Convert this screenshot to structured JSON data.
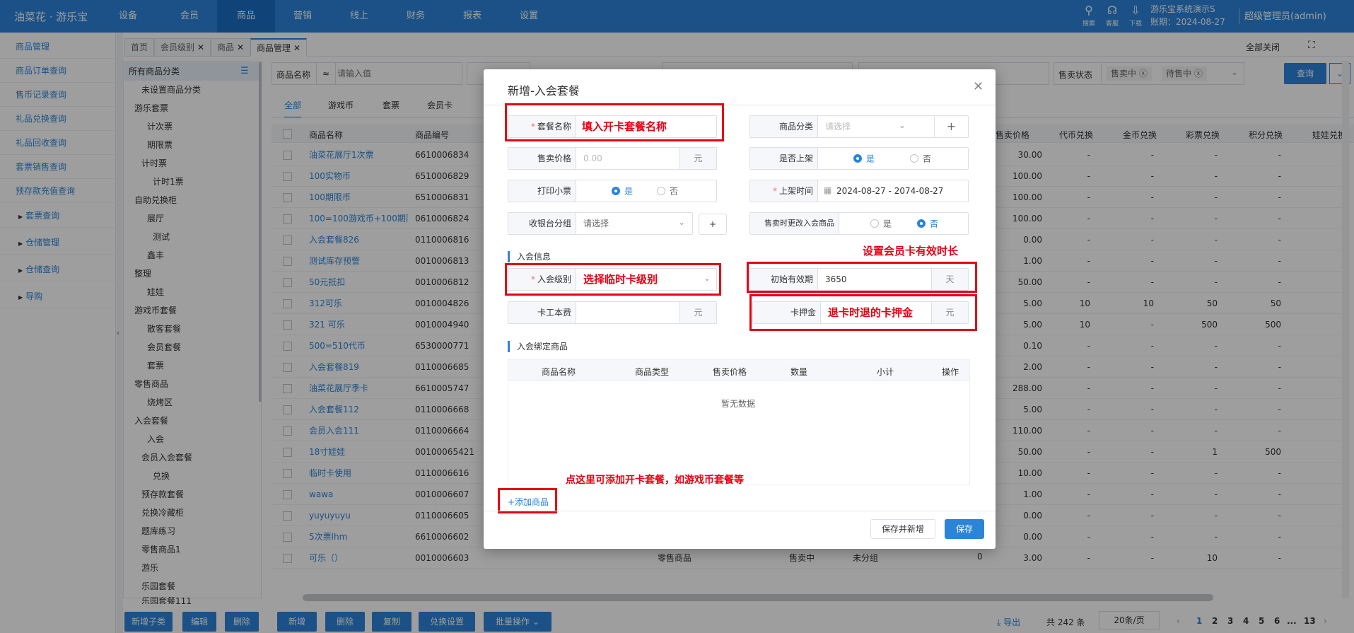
{
  "brand": "油菜花 · 游乐宝",
  "nav": [
    "设备",
    "会员",
    "商品",
    "营销",
    "线上",
    "财务",
    "报表",
    "设置"
  ],
  "top_icons": [
    {
      "icon": "search-icon",
      "label": "搜索"
    },
    {
      "icon": "headset-icon",
      "label": "客服"
    },
    {
      "icon": "download-icon",
      "label": "下载"
    }
  ],
  "system_name": "游乐宝系统演示S",
  "account_date": "账期：2024-08-27",
  "user": "超级管理员(admin)",
  "sidebar": [
    "商品管理",
    "商品订单查询",
    "售币记录查询",
    "礼品兑换查询",
    "礼品回收查询",
    "套票销售查询",
    "预存款充值查询",
    "套票查询",
    "仓储管理",
    "仓储查询",
    "导购"
  ],
  "tabs": [
    {
      "label": "首页"
    },
    {
      "label": "会员级别"
    },
    {
      "label": "商品"
    },
    {
      "label": "商品管理"
    }
  ],
  "close_all": "全部关闭",
  "tree": [
    "所有商品分类",
    "未设置商品分类",
    "游乐套票",
    "计次票",
    "期限票",
    "计时票",
    "计时1票",
    "自助兑换柜",
    "展厅",
    "测试",
    "鑫丰",
    "整理",
    "娃娃",
    "游戏币套餐",
    "散客套餐",
    "会员套餐",
    "套票",
    "零售商品",
    "烧烤区",
    "入会套餐",
    "入会",
    "会员入会套餐",
    "兑换",
    "预存款套餐",
    "兑换冷藏柜",
    "题库练习",
    "零售商品1",
    "游乐",
    "乐园套餐",
    "乐园套餐111"
  ],
  "filter": {
    "name_label": "商品名称",
    "op": "≈",
    "placeholder": "请输入值",
    "status_label": "售卖状态",
    "status_tags": [
      "售卖中",
      "待售中"
    ],
    "query": "查询"
  },
  "cat_tabs": [
    "全部",
    "游戏币",
    "套票",
    "会员卡"
  ],
  "table": {
    "headers": [
      "商品名称",
      "商品编号",
      "售卖价格",
      "代币兑换",
      "金币兑换",
      "彩票兑换",
      "积分兑换",
      "娃娃兑换"
    ],
    "rows": [
      [
        "油菜花展厅1次票",
        "6610006834",
        "30.00",
        "-",
        "-",
        "-",
        "-"
      ],
      [
        "100实物币",
        "6510006829",
        "100.00",
        "-",
        "-",
        "-",
        "-"
      ],
      [
        "100期限币",
        "6510006831",
        "100.00",
        "-",
        "-",
        "-",
        "-"
      ],
      [
        "100=100游戏币+100期限",
        "0610006824",
        "100.00",
        "-",
        "-",
        "-",
        "-"
      ],
      [
        "入会套餐826",
        "0110006816",
        "0.00",
        "-",
        "-",
        "-",
        "-"
      ],
      [
        "测试库存预警",
        "0010006813",
        "1.00",
        "-",
        "-",
        "-",
        "-"
      ],
      [
        "50元抵扣",
        "0010006812",
        "50.00",
        "-",
        "-",
        "-",
        "-"
      ],
      [
        "312可乐",
        "0010004826",
        "5.00",
        "10",
        "10",
        "50",
        "50"
      ],
      [
        "321 可乐",
        "0010004940",
        "5.00",
        "10",
        "-",
        "500",
        "500"
      ],
      [
        "500=510代币",
        "6530000771",
        "0.10",
        "-",
        "-",
        "-",
        "-"
      ],
      [
        "入会套餐819",
        "0110006685",
        "2.00",
        "-",
        "-",
        "-",
        "-"
      ],
      [
        "油菜花展厅季卡",
        "6610005747",
        "288.00",
        "-",
        "-",
        "-",
        "-"
      ],
      [
        "入会套餐112",
        "0110006668",
        "5.00",
        "-",
        "-",
        "-",
        "-"
      ],
      [
        "会员入会111",
        "0110006664",
        "110.00",
        "-",
        "-",
        "-",
        "-"
      ],
      [
        "18寸娃娃",
        "00100065421",
        "50.00",
        "-",
        "-",
        "1",
        "500"
      ],
      [
        "临时卡使用",
        "0110006616",
        "10.00",
        "-",
        "-",
        "-",
        "-"
      ],
      [
        "wawa",
        "0010006607",
        "1.00",
        "-",
        "-",
        "-",
        "-"
      ],
      [
        "yuyuyuyu",
        "0110006605",
        "0.00",
        "-",
        "-",
        "-",
        "-"
      ],
      [
        "5次票lhm",
        "6610006602",
        "0.00",
        "-",
        "-",
        "-",
        "-"
      ],
      [
        "可乐（）",
        "0010006603",
        "3.00",
        "-",
        "-",
        "10",
        "-"
      ]
    ],
    "last_row_extra": {
      "type": "零售商品",
      "status": "售卖中",
      "group": "未分组",
      "stock": "0"
    }
  },
  "tree_buttons": [
    "新增子类",
    "编辑",
    "删除"
  ],
  "bottom_buttons": [
    "新增",
    "删除",
    "复制",
    "兑换设置",
    "批量操作"
  ],
  "pagination": {
    "export": "导出",
    "total": "共 242 条",
    "per_page": "20条/页",
    "pages": [
      "1",
      "2",
      "3",
      "4",
      "5",
      "6",
      "...",
      "13"
    ]
  },
  "dialog": {
    "title": "新增-入会套餐",
    "name_label": "套餐名称",
    "name_value": "填入开卡套餐名称",
    "category_label": "商品分类",
    "category_placeholder": "请选择",
    "price_label": "售卖价格",
    "price_placeholder": "0.00",
    "yuan": "元",
    "on_shelf_label": "是否上架",
    "yes": "是",
    "no": "否",
    "print_label": "打印小票",
    "shelf_time_label": "上架时间",
    "shelf_time_value": "2024-08-27  - 2074-08-27",
    "cashier_label": "收银台分组",
    "cashier_placeholder": "请选择",
    "change_label": "售卖时更改入会商品",
    "join_info": "入会信息",
    "level_label": "入会级别",
    "level_value": "选择临时卡级别",
    "validity_label": "初始有效期",
    "validity_value": "3650",
    "day": "天",
    "card_cost_label": "卡工本费",
    "deposit_label": "卡押金",
    "deposit_value": "退卡时退的卡押金",
    "anno_validity": "设置会员卡有效时长",
    "bind_title": "入会绑定商品",
    "bind_headers": [
      "商品名称",
      "商品类型",
      "售卖价格",
      "数量",
      "小计",
      "操作"
    ],
    "empty": "暂无数据",
    "anno_add": "点这里可添加开卡套餐，如游戏币套餐等",
    "add_link": "+添加商品",
    "save_new": "保存并新增",
    "save": "保存"
  }
}
